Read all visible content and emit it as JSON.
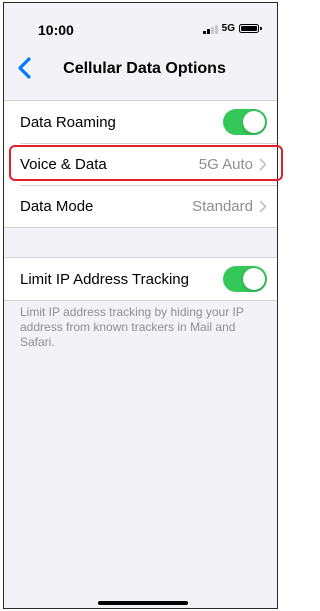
{
  "status_bar": {
    "time": "10:00",
    "network": "5G",
    "signal_bars": 2,
    "signal_bars_total": 4
  },
  "nav": {
    "title": "Cellular Data Options",
    "back_icon": "chevron-left-icon"
  },
  "settings": {
    "group_1": [
      {
        "label": "Data Roaming",
        "type": "toggle",
        "on": true
      },
      {
        "label": "Voice & Data",
        "type": "disclosure",
        "value": "5G Auto",
        "highlighted": true
      },
      {
        "label": "Data Mode",
        "type": "disclosure",
        "value": "Standard"
      }
    ],
    "group_2": [
      {
        "label": "Limit IP Address Tracking",
        "type": "toggle",
        "on": true
      }
    ],
    "group_2_footer": "Limit IP address tracking by hiding your IP address from known trackers in Mail and Safari."
  },
  "colors": {
    "accent": "#007aff",
    "toggle_on": "#34c759",
    "highlight": "#e0202a",
    "background": "#f2f2f7",
    "secondary_text": "#8e8e93"
  }
}
